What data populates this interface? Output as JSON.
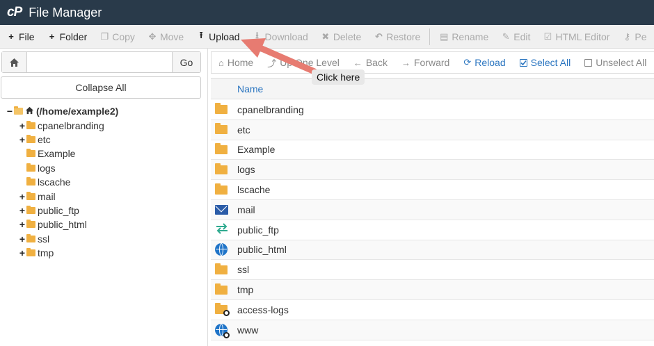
{
  "header": {
    "logo": "cP",
    "title": "File Manager"
  },
  "toolbar": [
    {
      "label": "File",
      "icon": "plus-icon",
      "glyph": "+",
      "enabled": true,
      "name": "new-file-button"
    },
    {
      "label": "Folder",
      "icon": "plus-icon",
      "glyph": "+",
      "enabled": true,
      "name": "new-folder-button"
    },
    {
      "label": "Copy",
      "icon": "copy-icon",
      "glyph": "❐",
      "enabled": false,
      "name": "copy-button"
    },
    {
      "label": "Move",
      "icon": "move-icon",
      "glyph": "✥",
      "enabled": false,
      "name": "move-button"
    },
    {
      "label": "Upload",
      "icon": "upload-icon",
      "glyph": "⭱",
      "enabled": true,
      "name": "upload-button"
    },
    {
      "label": "Download",
      "icon": "download-icon",
      "glyph": "⭳",
      "enabled": false,
      "name": "download-button"
    },
    {
      "label": "Delete",
      "icon": "delete-icon",
      "glyph": "✖",
      "enabled": false,
      "name": "delete-button"
    },
    {
      "label": "Restore",
      "icon": "restore-icon",
      "glyph": "↶",
      "enabled": false,
      "name": "restore-button"
    },
    {
      "label": "Rename",
      "icon": "rename-icon",
      "glyph": "▤",
      "enabled": false,
      "name": "rename-button",
      "sep_before": true
    },
    {
      "label": "Edit",
      "icon": "pencil-icon",
      "glyph": "✎",
      "enabled": false,
      "name": "edit-button"
    },
    {
      "label": "HTML Editor",
      "icon": "html-editor-icon",
      "glyph": "☑",
      "enabled": false,
      "name": "html-editor-button"
    },
    {
      "label": "Pe",
      "icon": "key-icon",
      "glyph": "⚷",
      "enabled": false,
      "name": "permissions-button"
    }
  ],
  "path": {
    "value": "",
    "go_label": "Go"
  },
  "collapse_label": "Collapse All",
  "tree": {
    "root": "(/home/example2)",
    "items": [
      {
        "label": "cpanelbranding",
        "expandable": true
      },
      {
        "label": "etc",
        "expandable": true
      },
      {
        "label": "Example",
        "expandable": false
      },
      {
        "label": "logs",
        "expandable": false
      },
      {
        "label": "lscache",
        "expandable": false
      },
      {
        "label": "mail",
        "expandable": true
      },
      {
        "label": "public_ftp",
        "expandable": true
      },
      {
        "label": "public_html",
        "expandable": true
      },
      {
        "label": "ssl",
        "expandable": true
      },
      {
        "label": "tmp",
        "expandable": true
      }
    ]
  },
  "nav": [
    {
      "label": "Home",
      "glyph": "⌂",
      "icon": "home-icon",
      "active": false,
      "name": "nav-home-button"
    },
    {
      "label": "Up One Level",
      "glyph": "⤴",
      "icon": "up-level-icon",
      "active": false,
      "name": "nav-up-one-level-button"
    },
    {
      "label": "Back",
      "glyph": "←",
      "icon": "arrow-left-icon",
      "active": false,
      "name": "nav-back-button"
    },
    {
      "label": "Forward",
      "glyph": "→",
      "icon": "arrow-right-icon",
      "active": false,
      "name": "nav-forward-button"
    },
    {
      "label": "Reload",
      "glyph": "⟳",
      "icon": "reload-icon",
      "active": true,
      "name": "nav-reload-button"
    },
    {
      "label": "Select All",
      "glyph": "check",
      "icon": "checkbox-checked-icon",
      "active": true,
      "name": "nav-select-all-button"
    },
    {
      "label": "Unselect All",
      "glyph": "box",
      "icon": "checkbox-empty-icon",
      "active": false,
      "name": "nav-unselect-all-button"
    }
  ],
  "table": {
    "column": "Name",
    "rows": [
      {
        "name": "cpanelbranding",
        "type": "folder"
      },
      {
        "name": "etc",
        "type": "folder"
      },
      {
        "name": "Example",
        "type": "folder"
      },
      {
        "name": "logs",
        "type": "folder"
      },
      {
        "name": "lscache",
        "type": "folder"
      },
      {
        "name": "mail",
        "type": "mail"
      },
      {
        "name": "public_ftp",
        "type": "ftp"
      },
      {
        "name": "public_html",
        "type": "web"
      },
      {
        "name": "ssl",
        "type": "folder"
      },
      {
        "name": "tmp",
        "type": "folder"
      },
      {
        "name": "access-logs",
        "type": "folder-link"
      },
      {
        "name": "www",
        "type": "web-link"
      }
    ]
  },
  "annotation": {
    "text": "Click here",
    "arrow_color": "#e77b71"
  },
  "colors": {
    "header_bg": "#293a4a",
    "accent": "#2a75c0",
    "folder": "#f0b041"
  }
}
